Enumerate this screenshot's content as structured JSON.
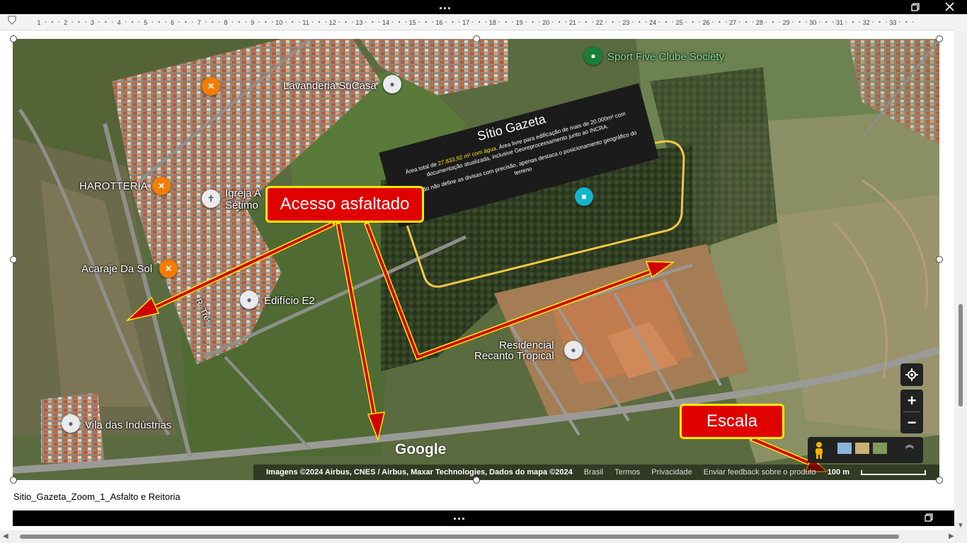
{
  "window": {
    "top_more_label": "...",
    "bottom_more_label": "...",
    "restore_icon": "restore-window-icon",
    "close_icon": "close-icon"
  },
  "ruler": {
    "numbers": [
      "1",
      "2",
      "3",
      "4",
      "5",
      "6",
      "7",
      "8",
      "9",
      "10",
      "11",
      "12",
      "13",
      "14",
      "15",
      "16",
      "17",
      "18",
      "19",
      "20",
      "21",
      "22",
      "23",
      "24",
      "25",
      "26",
      "27",
      "28",
      "29",
      "30",
      "31",
      "32",
      "33"
    ]
  },
  "map": {
    "pois": {
      "sport_five": "Sport Five Clube Society",
      "lavanderia": "Lavanderia SuCasa",
      "harotteria": "HAROTTERIA",
      "igreja_line1": "Igreja A",
      "igreja_line2": "Sétimo",
      "acaraje": "Acaraje Da Sol",
      "edificio": "Edifício E2",
      "r_tres": "R. Três",
      "residencial_line1": "Residencial",
      "residencial_line2": "Recanto Tropical",
      "vila": "Vila das Indústrias"
    },
    "infobox": {
      "title": "Sítio Gazeta",
      "desc_prefix": "Área total de ",
      "desc_highlight": "27.833,92 m² com água",
      "desc_suffix": ". Área livre para edificação de mais de 20.000m² com documentação atualizada, inclusive Georeprocessamento junto ao INCRA.",
      "note": "A seleção não define as divisas com precisão, apenas destaca o posicionamento geográfico do terreno"
    },
    "callouts": {
      "access": "Acesso asfaltado",
      "scale": "Escala"
    },
    "google_logo": "Google",
    "attribution": {
      "imagery": "Imagens ©2024 Airbus, CNES / Airbus, Maxar Technologies, Dados do mapa ©2024",
      "country": "Brasil",
      "terms": "Termos",
      "privacy": "Privacidade",
      "feedback": "Enviar feedback sobre o produto",
      "scale": "100 m"
    },
    "controls": {
      "locate_icon": "my-location-icon",
      "zoom_in": "+",
      "zoom_out": "−",
      "pegman_icon": "pegman-icon",
      "layers_icon": "layers-icon",
      "expand_icon": "chevron-up-double-icon"
    },
    "colors": {
      "callout_bg": "#e00000",
      "callout_border": "#ffea00",
      "selection_border": "#f2c744",
      "highlight_text": "#ffe21a"
    }
  },
  "caption": "Sitio_Gazeta_Zoom_1_Asfalto e Reitoria"
}
